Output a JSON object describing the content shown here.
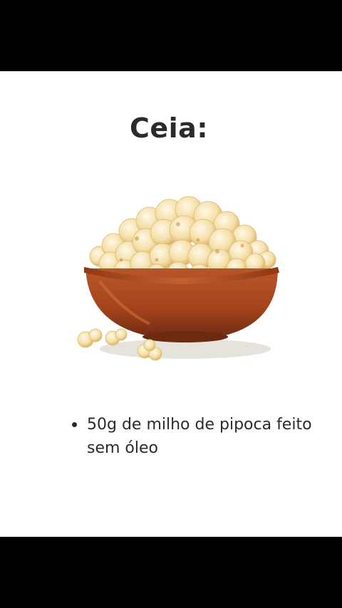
{
  "slide": {
    "title": "Ceia:",
    "image": {
      "icon": "popcorn-bowl-icon",
      "bowl_color": "#a5441c",
      "popcorn_color": "#f4dfa8"
    },
    "items": [
      {
        "text": "50g de milho de pipoca feito sem óleo"
      }
    ]
  },
  "colors": {
    "letterbox": "#000000",
    "background": "#ffffff",
    "text": "#2b2b2b"
  }
}
